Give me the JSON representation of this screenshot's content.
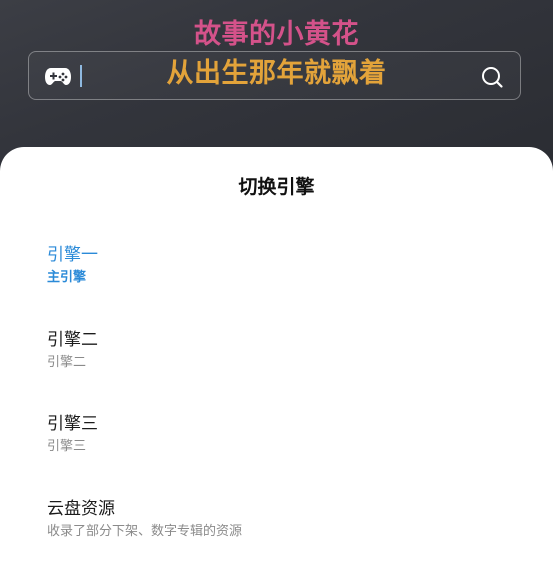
{
  "lyrics": {
    "line1": "故事的小黄花",
    "line2": "从出生那年就飘着"
  },
  "search": {
    "value": "",
    "leading_icon": "gamepad-icon",
    "trailing_icon": "search-icon"
  },
  "sheet": {
    "title": "切换引擎",
    "engines": [
      {
        "name": "引擎一",
        "desc": "主引擎",
        "selected": true
      },
      {
        "name": "引擎二",
        "desc": "引擎二",
        "selected": false
      },
      {
        "name": "引擎三",
        "desc": "引擎三",
        "selected": false
      },
      {
        "name": "云盘资源",
        "desc": "收录了部分下架、数字专辑的资源",
        "selected": false
      }
    ]
  },
  "colors": {
    "accent": "#2a8ad8",
    "lyric_pink": "#d4528a",
    "lyric_orange": "#e3a33a",
    "header_bg": "#33353c"
  }
}
